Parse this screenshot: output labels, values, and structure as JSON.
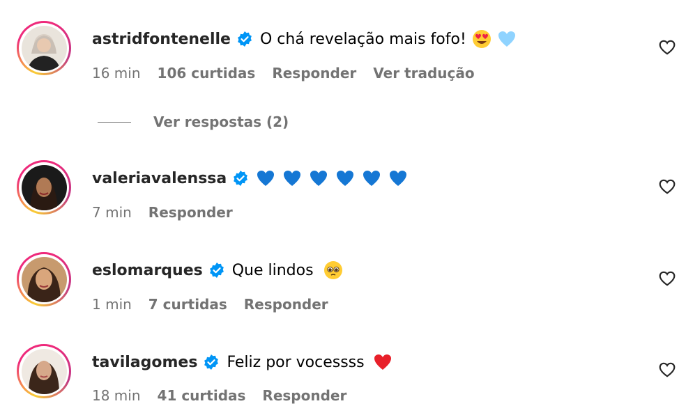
{
  "comments": [
    {
      "username": "astridfontenelle",
      "text": "O chá revelação mais fofo!",
      "emojis": [
        "heart-eyes-emoji",
        "light-blue-heart-emoji"
      ],
      "time": "16 min",
      "likes": "106 curtidas",
      "reply": "Responder",
      "translate": "Ver tradução",
      "view_replies": "Ver respostas (2)"
    },
    {
      "username": "valeriavalenssa",
      "text": "",
      "emojis": [
        "blue-heart-emoji",
        "blue-heart-emoji",
        "blue-heart-emoji",
        "blue-heart-emoji",
        "blue-heart-emoji",
        "blue-heart-emoji"
      ],
      "time": "7 min",
      "reply": "Responder"
    },
    {
      "username": "eslomarques",
      "text": "Que lindos",
      "emojis": [
        "pleading-face-emoji"
      ],
      "time": "1 min",
      "likes": "7 curtidas",
      "reply": "Responder"
    },
    {
      "username": "tavilagomes",
      "text": "Feliz por vocessss",
      "emojis": [
        "red-heart-emoji"
      ],
      "time": "18 min",
      "likes": "41 curtidas",
      "reply": "Responder"
    }
  ],
  "colors": {
    "verified": "#0095f6",
    "meta_text": "#737373",
    "username": "#262626"
  }
}
